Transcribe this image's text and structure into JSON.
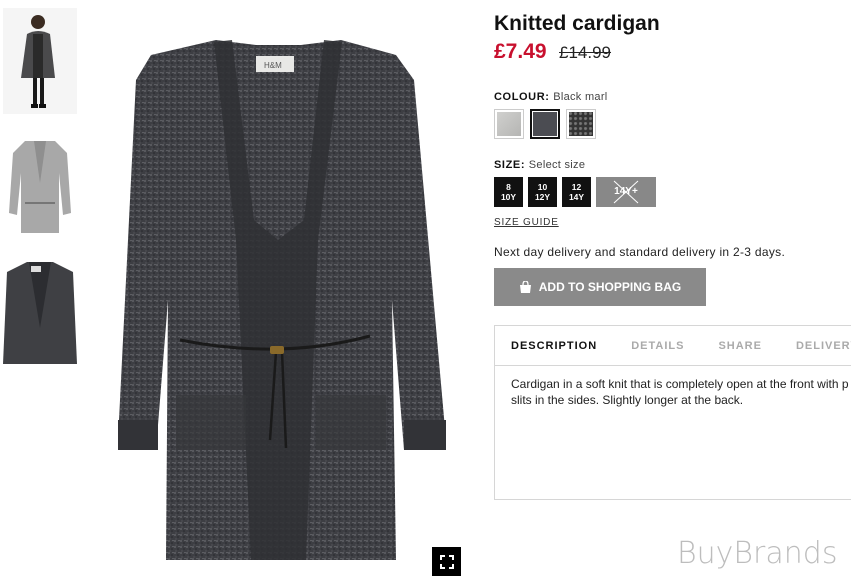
{
  "thumbnails": [
    {
      "icon": "model-wearing-cardigan-thumbnail"
    },
    {
      "icon": "light-grey-cardigan-thumbnail"
    },
    {
      "icon": "dark-cardigan-closeup-thumbnail"
    }
  ],
  "main_image": {
    "icon": "black-marl-cardigan-image",
    "brand_tag": "H&M"
  },
  "product": {
    "title": "Knitted cardigan",
    "price_new": "£7.49",
    "price_old": "£14.99",
    "colour_label": "COLOUR:",
    "colour_value": "Black marl",
    "colours": [
      {
        "name": "Light grey",
        "hex": "#c4c4c2"
      },
      {
        "name": "Black marl",
        "hex": "#4b4c52",
        "selected": true
      },
      {
        "name": "Dark speckle",
        "hex": "#3a3a3a"
      }
    ],
    "size_label": "SIZE:",
    "size_value": "Select size",
    "sizes": [
      {
        "line1": "8",
        "line2": "10Y",
        "available": true
      },
      {
        "line1": "10",
        "line2": "12Y",
        "available": true
      },
      {
        "line1": "12",
        "line2": "14Y",
        "available": true
      },
      {
        "line1": "14Y+",
        "line2": "",
        "available": false
      }
    ],
    "size_guide": "SIZE GUIDE",
    "delivery_note": "Next day delivery and standard delivery in 2-3 days.",
    "add_button": "ADD TO SHOPPING BAG"
  },
  "tabs": {
    "items": [
      "DESCRIPTION",
      "DETAILS",
      "SHARE",
      "DELIVERY"
    ],
    "active": "DESCRIPTION",
    "description_line1": "Cardigan in a soft knit that is completely open at the front with p",
    "description_line2": "slits in the sides. Slightly longer at the back."
  },
  "watermark": "BuyBrands",
  "colors": {
    "sale": "#c8102e",
    "button": "#8a8a8a",
    "size_bg": "#111111"
  }
}
